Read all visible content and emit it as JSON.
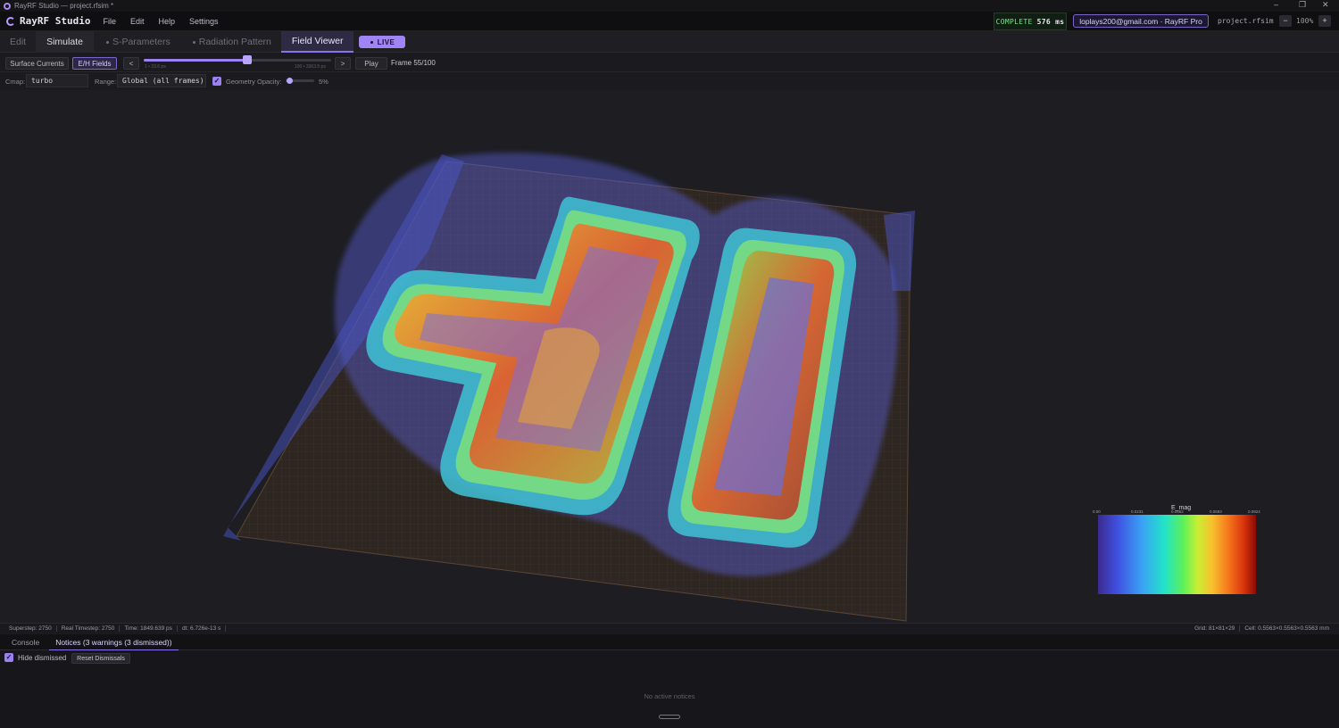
{
  "os_window": {
    "title": "RayRF Studio — project.rfsim *",
    "controls": [
      "–",
      "❐",
      "✕"
    ]
  },
  "app": {
    "brand": "RayRF Studio",
    "menu": [
      "File",
      "Edit",
      "Help",
      "Settings"
    ],
    "status": {
      "label": "COMPLETE",
      "time": "576 ms"
    },
    "account": "loplays200@gmail.com · RayRF Pro",
    "project": "project.rfsim",
    "zoom": {
      "minus": "−",
      "level": "100%",
      "plus": "+"
    }
  },
  "tabs": [
    {
      "label": "Edit"
    },
    {
      "label": "Simulate"
    },
    {
      "label": "S-Parameters"
    },
    {
      "label": "Radiation Pattern"
    },
    {
      "label": "Field Viewer"
    }
  ],
  "live_label": "LIVE",
  "toolbar": {
    "surface_currents": "Surface Currents",
    "eh_fields": "E/H Fields",
    "prev": "<",
    "next": ">",
    "play": "Play",
    "frame": "Frame 55/100",
    "frame_progress": 0.55,
    "slider_min_caption": "1 • 33.6 ps",
    "slider_max_caption": "100 • 3363.5 ps"
  },
  "controls": {
    "cmap_label": "Cmap:",
    "cmap_value": "turbo",
    "range_label": "Range:",
    "range_value": "Global (all frames)",
    "geometry_label": "Geometry",
    "opacity_label": "Opacity:",
    "opacity_value": "5%",
    "opacity_fraction": 0.05,
    "geometry_checked": true
  },
  "colorbar": {
    "title": "E_mag",
    "ticks": [
      "0.00",
      "0.0231",
      "0.0462",
      "0.0693",
      "0.0924"
    ],
    "colors": [
      "#3b2a8c",
      "#3aa2f5",
      "#5ef05a",
      "#f7c22e",
      "#8a0a05"
    ]
  },
  "statusbar": {
    "superstep": "Superstep: 2750",
    "real_timestep": "Real Timestep: 2750",
    "time": "Time: 1849.639 ps",
    "dt": "dt: 6.726e-13 s",
    "grid": "Grid: 81×81×29",
    "cell": "Cell: 0.5563×0.5563×0.5563 mm"
  },
  "bottom": {
    "tabs": [
      "Console",
      "Notices (3 warnings (3 dismissed))"
    ],
    "hide_dismissed": "Hide dismissed",
    "reset_dismissals": "Reset Dismissals",
    "empty_message": "No active notices"
  }
}
